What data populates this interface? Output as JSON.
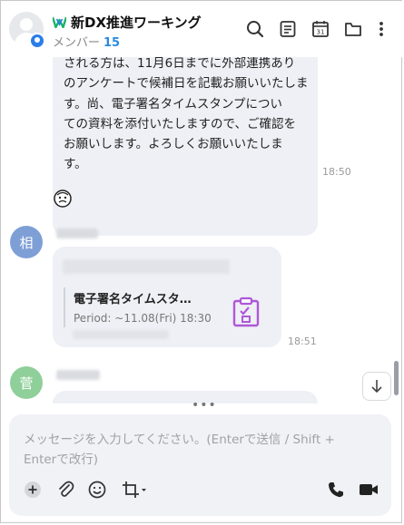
{
  "header": {
    "group_name": "新DX推進ワーキング",
    "member_label": "メンバー",
    "member_count": "15"
  },
  "messages": {
    "main_text": "される方は、11月6日までに外部連携あり\nのアンケートで候補日を記載お願いいたしま\nす。尚、電子署名タイムスタンプについ\nての資料を添付いたしますので、ご確認を\nお願いします。よろしくお願いいたしま\nす。",
    "main_time": "18:50",
    "sender2_avatar": "相",
    "card_title": "電子署名タイムスタ…",
    "card_period": "Period: ~11.08(Fri) 18:30",
    "card_time": "18:51",
    "sender3_avatar": "菅"
  },
  "composer": {
    "placeholder": "メッセージを入力してください。(Enterで送信 / Shift +\nEnterで改行)"
  },
  "colors": {
    "accent": "#2b8ae0",
    "avatar_blue": "#7e9fd6",
    "avatar_green": "#8fcf9a",
    "calendar_purple": "#b057d8"
  }
}
